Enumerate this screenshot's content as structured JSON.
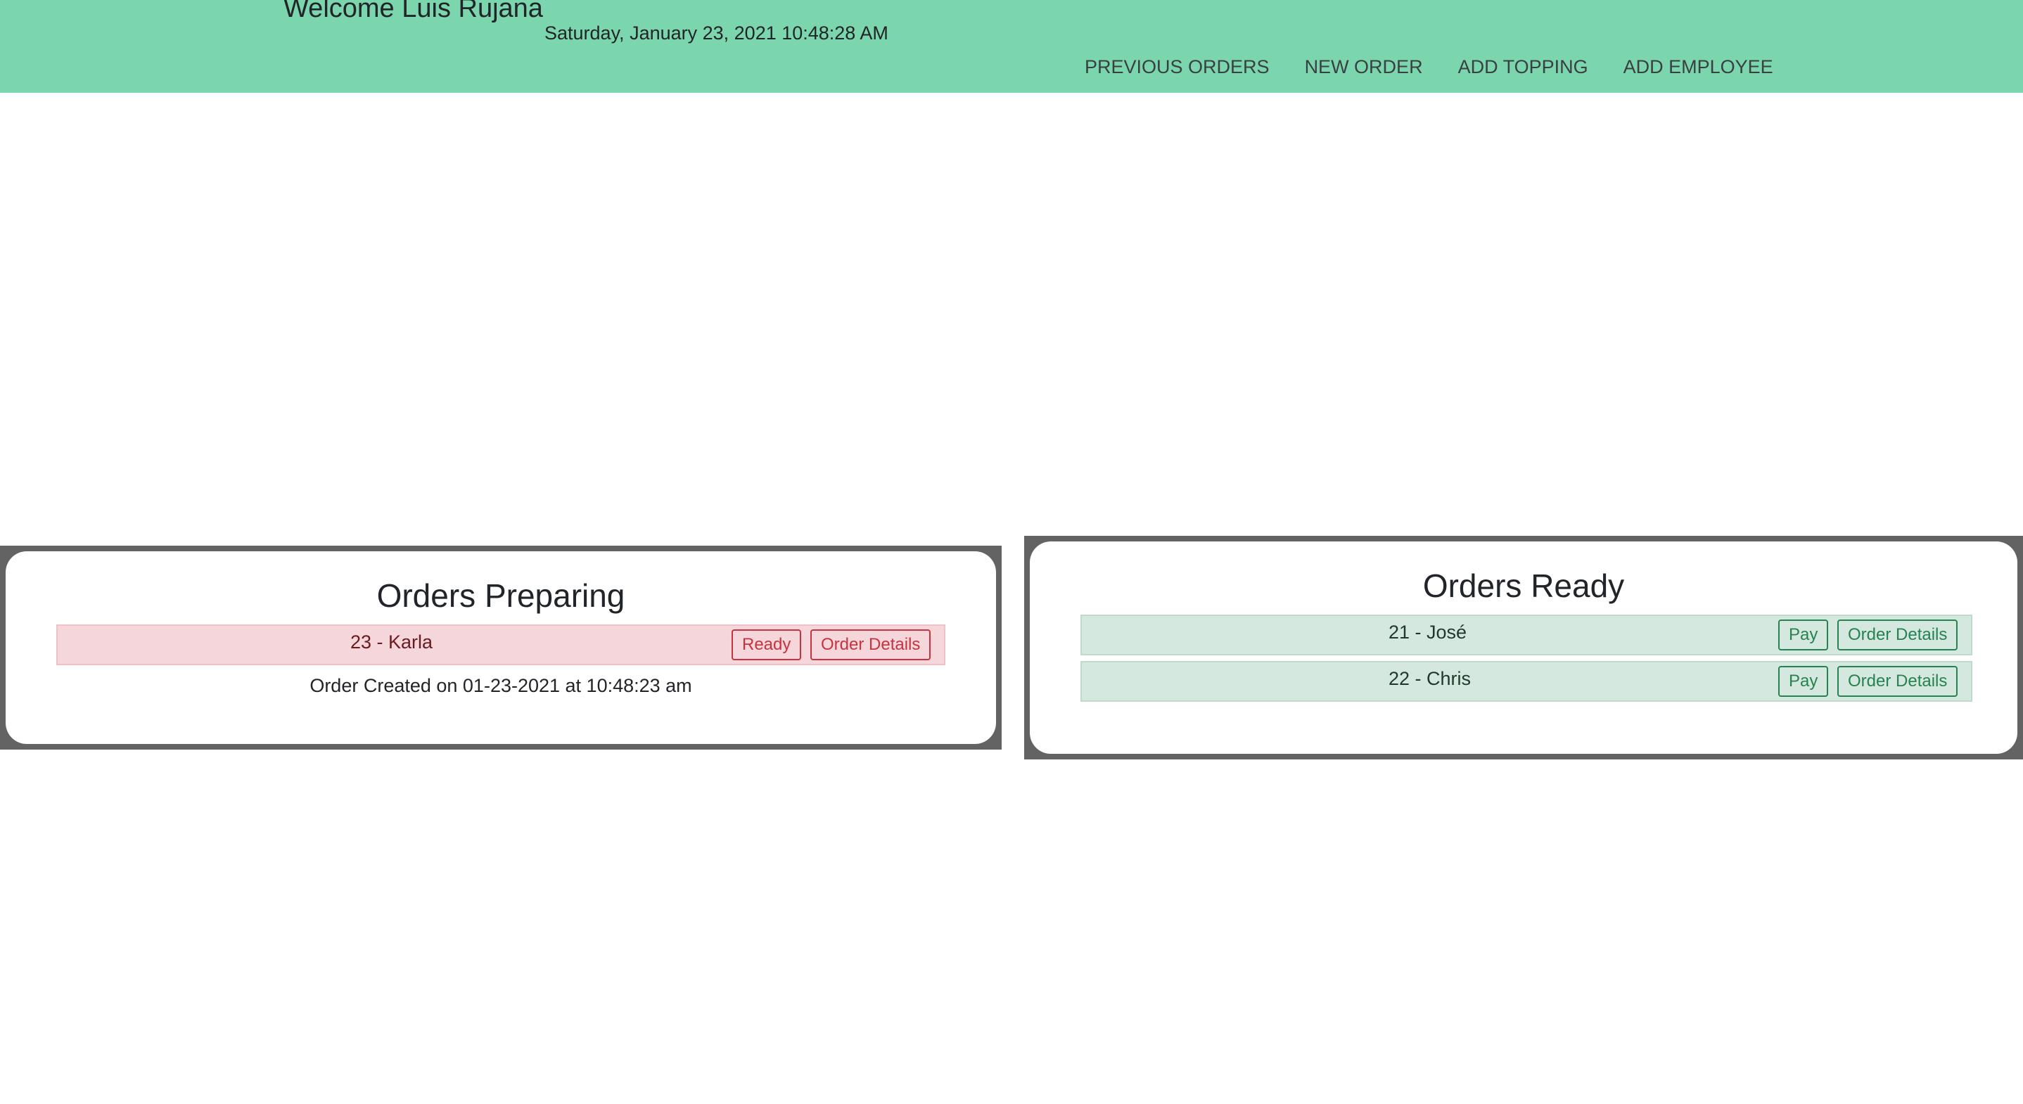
{
  "header": {
    "welcome": "Welcome Luis Rujana",
    "datetime": "Saturday, January 23, 2021 10:48:28 AM",
    "background_color": "#7bd5ad",
    "nav": [
      {
        "label": "PREVIOUS ORDERS"
      },
      {
        "label": "NEW ORDER"
      },
      {
        "label": "ADD TOPPING"
      },
      {
        "label": "ADD EMPLOYEE"
      }
    ]
  },
  "preparing": {
    "title": "Orders Preparing",
    "row_color": "#f5d6da",
    "orders": [
      {
        "label": "23 - Karla",
        "ready_button": "Ready",
        "details_button": "Order Details",
        "created": "Order Created on 01-23-2021 at 10:48:23 am"
      }
    ]
  },
  "ready": {
    "title": "Orders Ready",
    "row_color": "#d5e8df",
    "orders": [
      {
        "label": "21 - José",
        "pay_button": "Pay",
        "details_button": "Order Details"
      },
      {
        "label": "22 - Chris",
        "pay_button": "Pay",
        "details_button": "Order Details"
      }
    ]
  }
}
